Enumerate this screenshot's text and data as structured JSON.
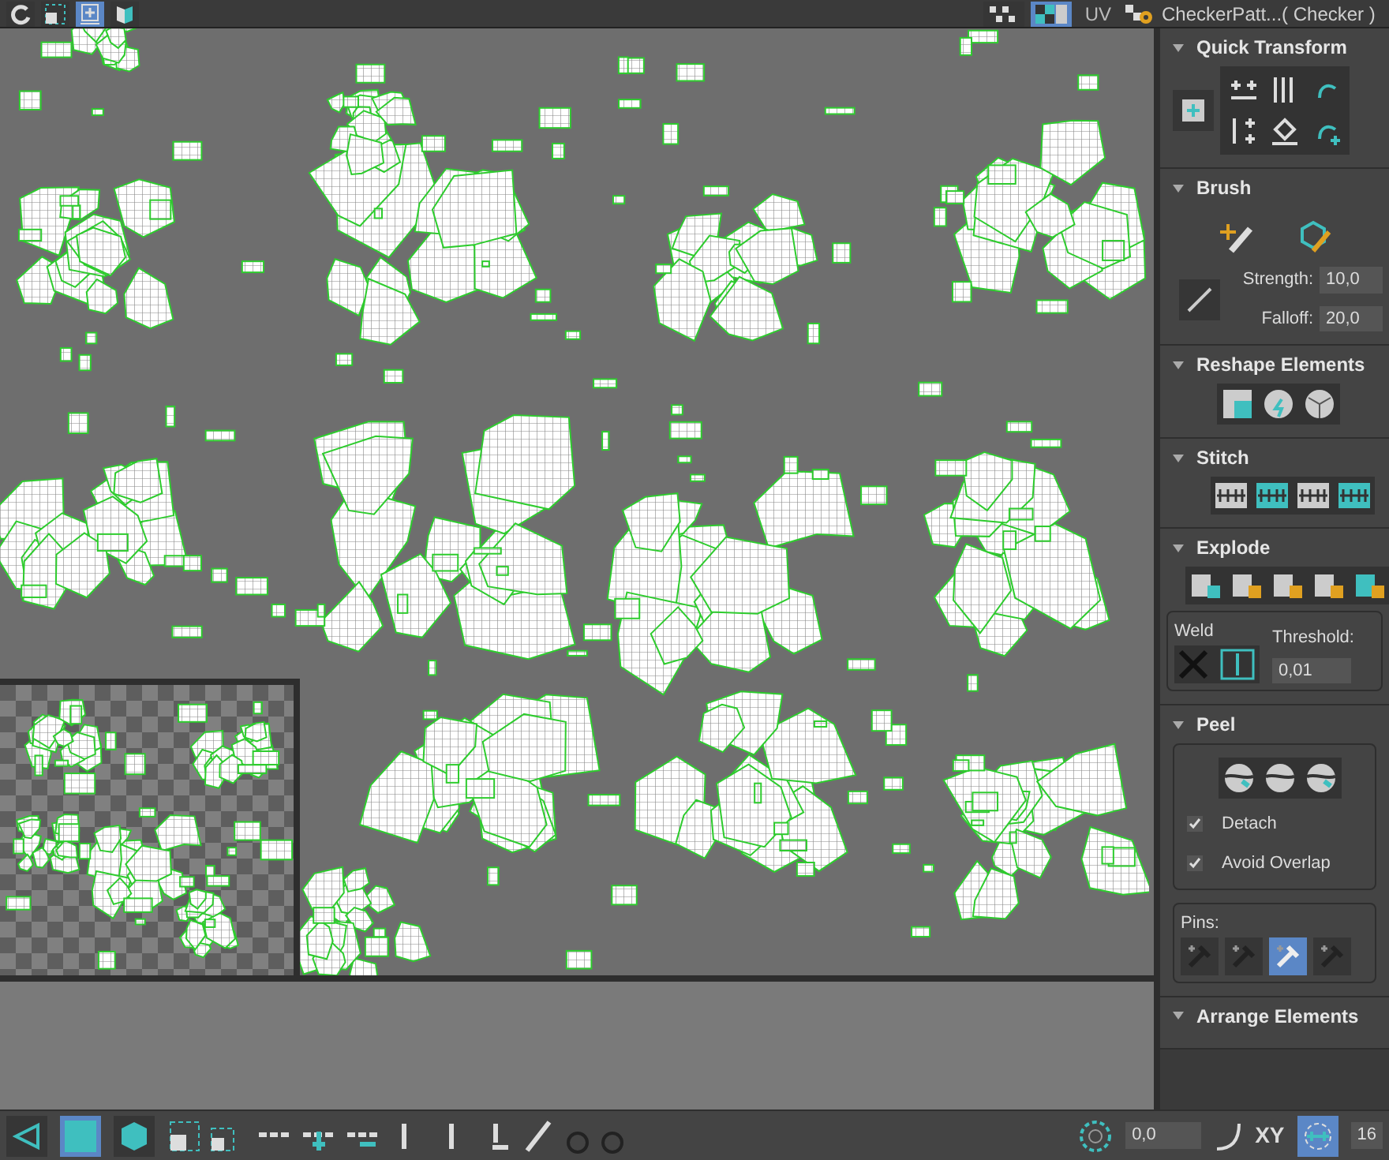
{
  "top_toolbar": {
    "left_buttons": [
      {
        "kind": "rotate",
        "selected": false
      },
      {
        "kind": "frame",
        "selected": false
      },
      {
        "kind": "align",
        "selected": true
      },
      {
        "kind": "mirror",
        "selected": false
      }
    ],
    "right_buttons": [
      {
        "kind": "checker",
        "selected": false
      },
      {
        "kind": "checker-teal",
        "selected": true
      }
    ],
    "uv_label": "UV",
    "texture": "CheckerPatt...( Checker )"
  },
  "panel": {
    "quick_transform": {
      "title": "Quick Transform"
    },
    "brush": {
      "title": "Brush",
      "strength_label": "Strength:",
      "strength": "10,0",
      "falloff_label": "Falloff:",
      "falloff": "20,0"
    },
    "reshape": {
      "title": "Reshape Elements"
    },
    "stitch": {
      "title": "Stitch"
    },
    "explode": {
      "title": "Explode",
      "weld_label": "Weld",
      "threshold_label": "Threshold:",
      "threshold": "0,01"
    },
    "peel": {
      "title": "Peel",
      "options": [
        {
          "label": "Detach",
          "checked": true
        },
        {
          "label": "Avoid Overlap",
          "checked": true
        }
      ],
      "pins_label": "Pins:",
      "pins": [
        {
          "selected": false
        },
        {
          "selected": false
        },
        {
          "selected": true
        },
        {
          "selected": false
        }
      ]
    },
    "arrange": {
      "title": "Arrange Elements"
    }
  },
  "bottom_toolbar": {
    "modes": [
      {
        "kind": "vertex",
        "selected": false
      },
      {
        "kind": "face",
        "selected": true
      },
      {
        "kind": "element",
        "selected": false
      }
    ],
    "angle": "0,0",
    "axis": "XY",
    "snap_selected": true,
    "value": "16"
  }
}
